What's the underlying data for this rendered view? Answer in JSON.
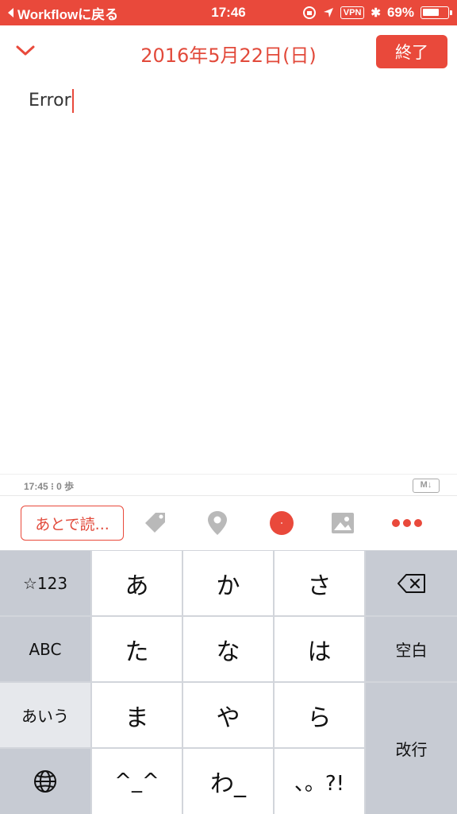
{
  "status_bar": {
    "back_app": "Workflowに戻る",
    "time": "17:46",
    "vpn": "VPN",
    "battery": "69%",
    "battery_level": 0.69,
    "bluetooth_glyph": "✱"
  },
  "header": {
    "title": "2016年5月22日(日)",
    "done_label": "終了"
  },
  "editor": {
    "text": "Error"
  },
  "info_bar": {
    "info": "17:45 ⁝ 0 歩",
    "markdown_badge": "M↓"
  },
  "toolbar": {
    "read_later_label": "あとで読...",
    "icons": [
      "tag-icon",
      "location-pin-icon",
      "record-dot-icon",
      "image-icon",
      "more-dots-icon"
    ],
    "accent_color": "#e9493b"
  },
  "keyboard": {
    "left": [
      "☆123",
      "ABC",
      "あいう"
    ],
    "globe_icon": "globe-icon",
    "rows": [
      [
        "あ",
        "か",
        "さ"
      ],
      [
        "た",
        "な",
        "は"
      ],
      [
        "ま",
        "や",
        "ら"
      ],
      [
        "^_^",
        "わ_",
        "、。?!"
      ]
    ],
    "right": {
      "delete_icon": "backspace-icon",
      "space": "空白",
      "enter": "改行"
    }
  },
  "colors": {
    "accent": "#e9493b",
    "keyboard_bg": "#d2d5db",
    "key_gray": "#c7cbd3"
  }
}
